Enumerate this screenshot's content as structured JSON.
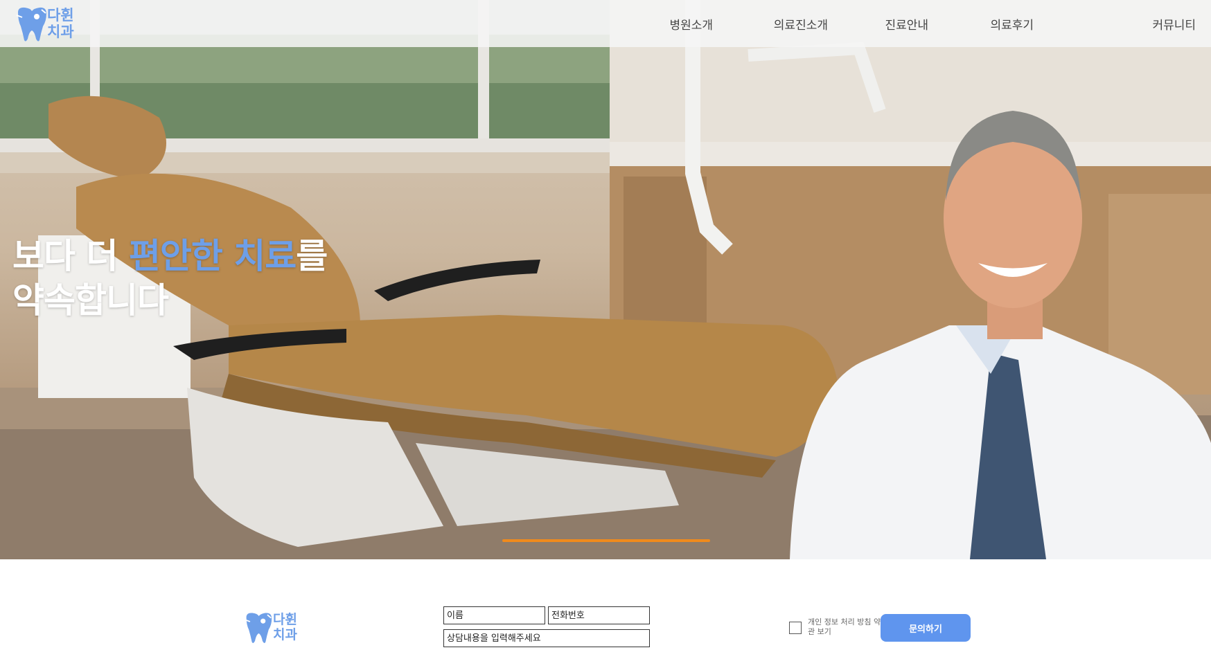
{
  "brand": {
    "name_line1": "다휜",
    "name_line2": "치과",
    "color": "#6e9fe8"
  },
  "nav": {
    "items": [
      {
        "label": "병원소개"
      },
      {
        "label": "의료진소개"
      },
      {
        "label": "진료안내"
      },
      {
        "label": "의료후기"
      },
      {
        "label": "커뮤니티"
      }
    ]
  },
  "hero": {
    "line1_part1": "보다 더 ",
    "line1_accent": "편안한 치료",
    "line1_part2": "를",
    "line2": "약속합니다",
    "accent_color": "#6e9fe8",
    "progress_color": "#f08a1c"
  },
  "form": {
    "name_placeholder": "이름",
    "phone_placeholder": "전화번호",
    "message_placeholder": "상담내용을 입력해주세요",
    "consent_label": "개인 정보 처리 방침 약관 보기",
    "submit_label": "문의하기",
    "submit_color": "#5f95ee"
  }
}
